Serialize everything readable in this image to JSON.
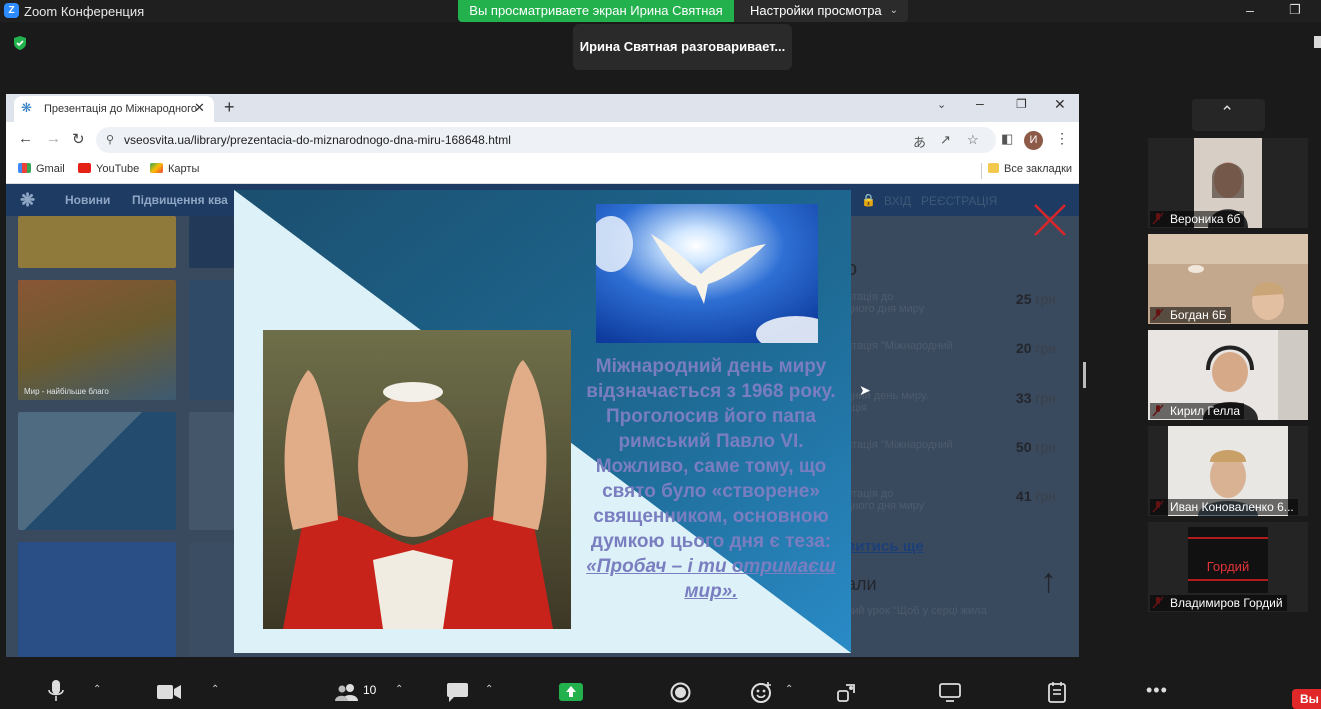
{
  "zoom": {
    "title": "Zoom Конференция",
    "share_banner": "Вы просматриваете экран Ирина Святная",
    "view_settings": "Настройки просмотра",
    "speaker": "Ирина Святная разговаривает..."
  },
  "browser": {
    "tab_title": "Презентація до Міжнародного",
    "url": "vseosvita.ua/library/prezentacia-do-miznarodnogo-dna-miru-168648.html",
    "profile_initial": "И",
    "bookmarks": [
      "Gmail",
      "YouTube",
      "Карты"
    ],
    "all_bookmarks": "Все закладки"
  },
  "site": {
    "nav": [
      "Новини",
      "Підвищення ква"
    ],
    "login": "ВХІД",
    "register": "РЕЄСТРАЦІЯ",
    "section_letter": "о",
    "thumb_caption": "Мир - найбільше благо",
    "items": [
      {
        "title": "нтація до",
        "title2": "дного дня миру",
        "price": "25",
        "currency": "грн"
      },
      {
        "title": "нтація \"Міжнародний",
        "title2": "\"",
        "price": "20",
        "currency": "грн"
      },
      {
        "title": "дний день миру.",
        "title2": "ація",
        "price": "33",
        "currency": "грн"
      },
      {
        "title": "нтація \"Міжнародний",
        "title2": "\"",
        "price": "50",
        "currency": "грн"
      },
      {
        "title": "нтація до",
        "title2": "дного дня миру",
        "price": "41",
        "currency": "грн"
      }
    ],
    "see_more": "витись ще",
    "section2": "али",
    "section2_item": "ний урок \"Щоб у серці жила"
  },
  "slide": {
    "text": "Міжнародний день миру відзначається з 1968 року. Проголосив його папа римський Павло VI. Можливо, саме тому, що свято було «створене» священником, основною думкою цього дня є теза:",
    "quote": "«Пробач – і ти отримаєш мир».",
    "colors": {
      "background": "#dcf1f7",
      "triangle": "#1d5f86",
      "text": "#7a7ec0"
    }
  },
  "participants": [
    {
      "name": "Вероника 6б",
      "muted": true
    },
    {
      "name": "Богдан 6Б",
      "muted": true
    },
    {
      "name": "Кирил Гелла",
      "muted": true
    },
    {
      "name": "Иван Коноваленко 6...",
      "muted": true
    },
    {
      "name": "Владимиров Гордий",
      "muted": true,
      "avatar_text": "Гордий"
    }
  ],
  "toolbar": {
    "participants_count": "10",
    "end_label": "Вы"
  }
}
